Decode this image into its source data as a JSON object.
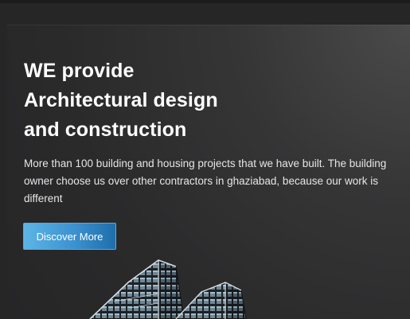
{
  "hero": {
    "title_lines": [
      "WE provide",
      "Architectural design",
      "and construction"
    ],
    "description": "More than 100 building and housing projects that we have built. The building owner choose us over other contractors in ghaziabad, because our work is different",
    "cta_label": "Discover More"
  }
}
